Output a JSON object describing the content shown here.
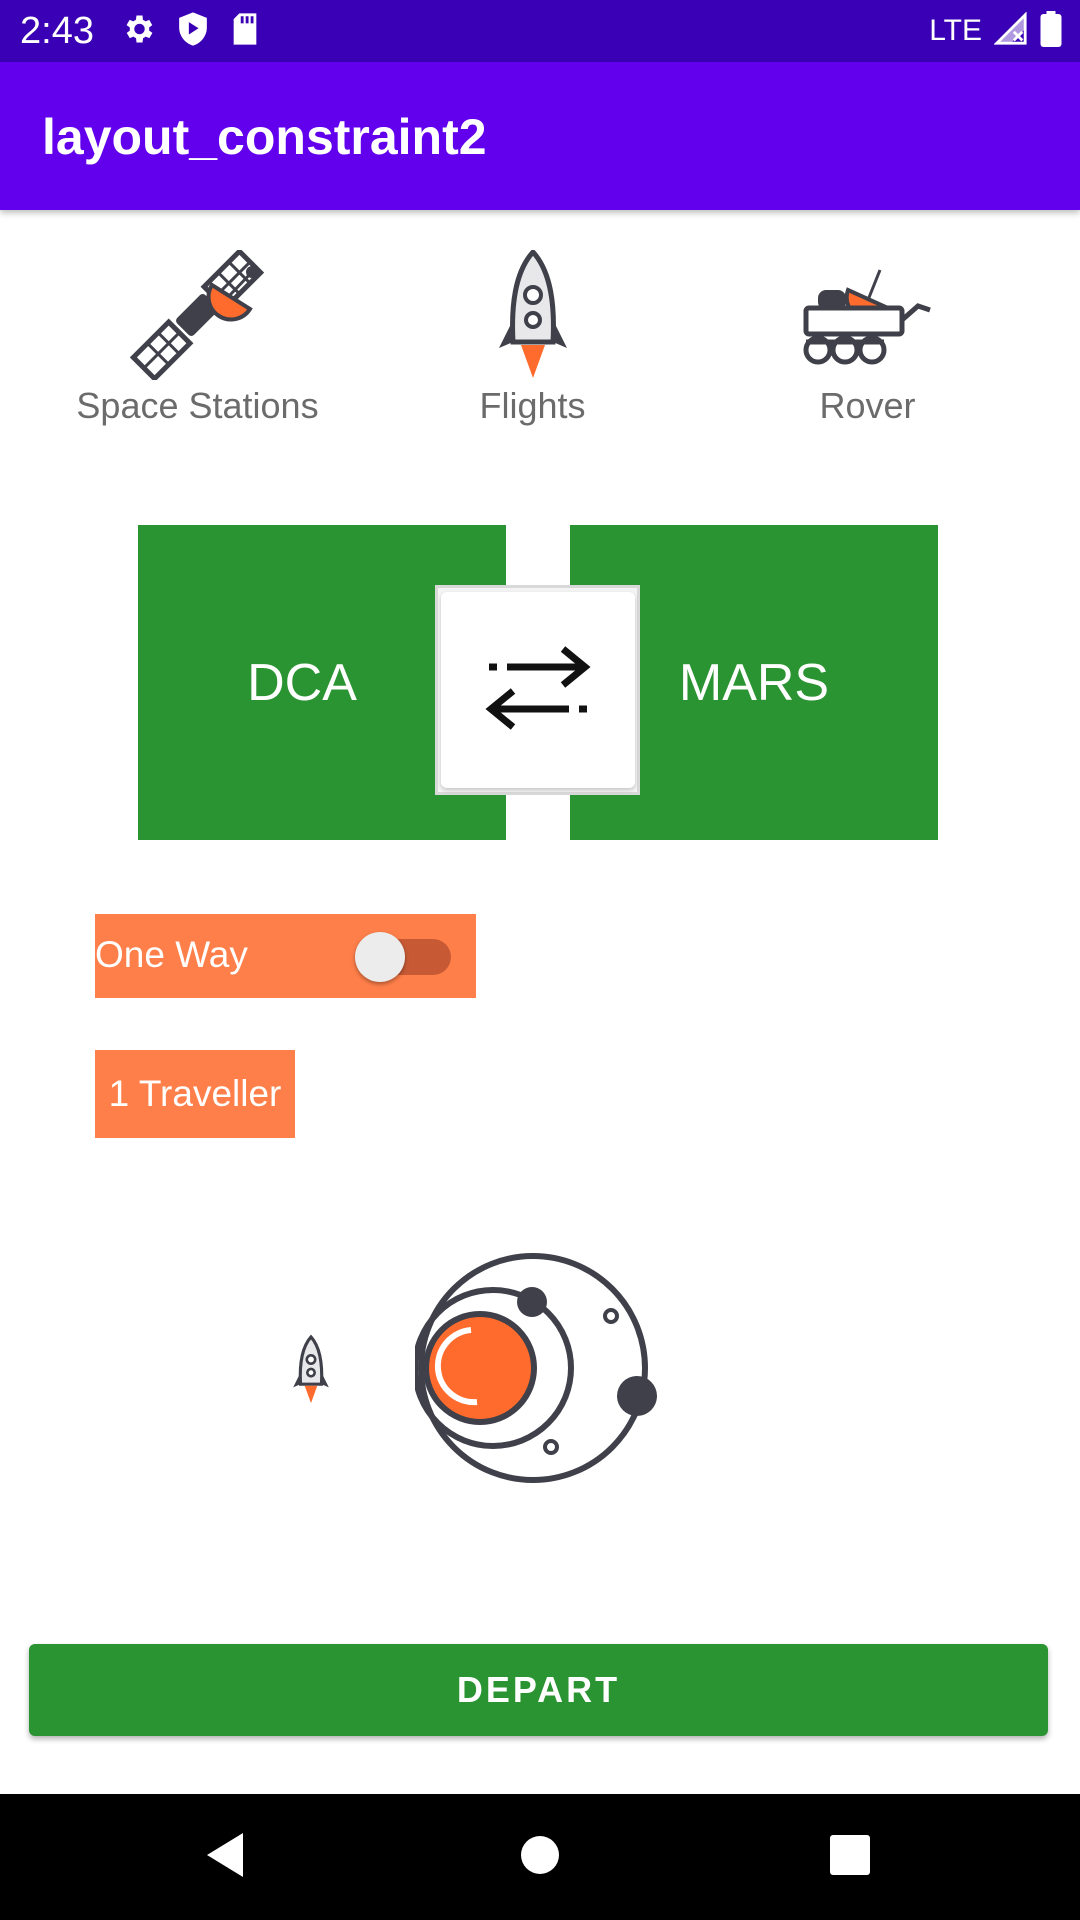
{
  "status_bar": {
    "time": "2:43",
    "network": "LTE",
    "icons": [
      "settings-icon",
      "shield-play-icon",
      "sd-card-icon",
      "signal-icon",
      "battery-icon"
    ]
  },
  "app_bar": {
    "title": "layout_constraint2",
    "color": "#6200ee"
  },
  "categories": [
    {
      "label": "Space Stations",
      "icon": "satellite-icon"
    },
    {
      "label": "Flights",
      "icon": "rocket-icon"
    },
    {
      "label": "Rover",
      "icon": "rover-icon"
    }
  ],
  "route": {
    "from": "DCA",
    "to": "MARS",
    "swap_icon": "swap-arrows-icon",
    "color": "#2a9432"
  },
  "options": {
    "one_way_label": "One Way",
    "one_way_enabled": false,
    "travellers_label": "1 Traveller",
    "accent": "#ff7f4a"
  },
  "illustration": {
    "icons": [
      "small-rocket-icon",
      "planet-orbit-icon"
    ]
  },
  "depart_label": "DEPART",
  "nav_bar": {
    "icons": [
      "back-icon",
      "home-icon",
      "recents-icon"
    ]
  }
}
